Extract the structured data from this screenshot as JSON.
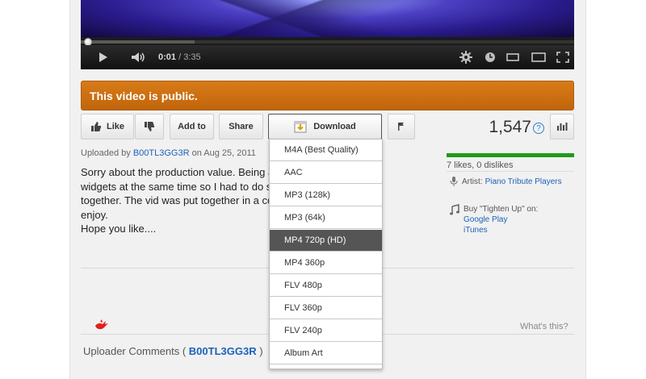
{
  "player": {
    "current_time": "0:01",
    "time_separator": "/",
    "total_time": "3:35",
    "buffered_progress_fraction": 0.23,
    "icons": {
      "play": "play-icon",
      "volume": "volume-icon",
      "settings": "gear-icon",
      "watch_later": "clock-icon",
      "small_player": "small-player-icon",
      "large_player": "large-player-icon",
      "fullscreen": "fullscreen-icon"
    }
  },
  "banner": {
    "text": "This video is public.",
    "color": "#c9700f"
  },
  "actions": {
    "like_label": "Like",
    "add_to_label": "Add to",
    "share_label": "Share",
    "download_label": "Download",
    "view_count": "1,547",
    "help_glyph": "?"
  },
  "download_menu": {
    "items": [
      "M4A (Best Quality)",
      "AAC",
      "MP3 (128k)",
      "MP3 (64k)",
      "MP4 720p (HD)",
      "MP4 360p",
      "FLV 480p",
      "FLV 360p",
      "FLV 240p",
      "Album Art"
    ],
    "selected_index": 4
  },
  "upload_info": {
    "prefix": "Uploaded by ",
    "user": "B00TL3GG3R",
    "suffix": " on Aug 25, 2011"
  },
  "description": {
    "text": "Sorry about the production value. Being arou                         e all the\nwidgets at the same time so I had to do se                        ice\ntogether. The vid was put together in a con                       nd iMovie,\nenjoy.\nHope you like...."
  },
  "sidebar": {
    "likes_text": "7 likes, 0 dislikes",
    "likes_fraction": 1.0,
    "likes_color": "#1f9c16",
    "artist_label": "Artist:",
    "artist_name": "Piano Tribute Players",
    "buy_text": "Buy \"Tighten Up\" on:",
    "store_1": "Google Play",
    "store_2": "iTunes"
  },
  "footer": {
    "whats_this": "What's this?",
    "uploader_comments_prefix": "Uploader Comments ( ",
    "uploader_comments_user": "B00TL3GG3R",
    "uploader_comments_suffix": " )"
  },
  "colors": {
    "link": "#1c62b9",
    "menu_selected_bg": "#555555"
  }
}
